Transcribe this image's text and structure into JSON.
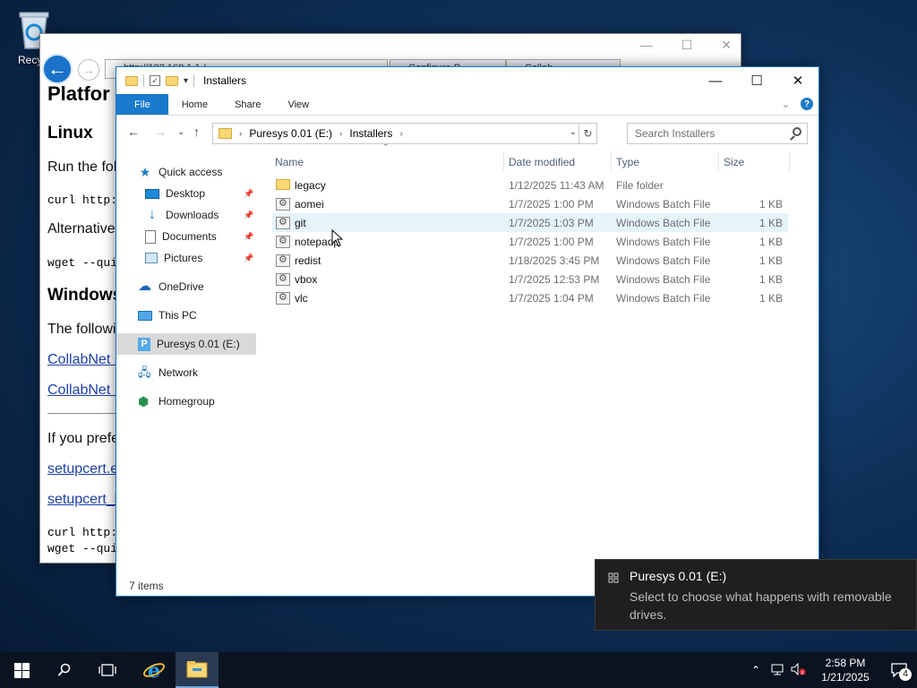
{
  "desktop": {
    "recycle_bin_label": "Recycl"
  },
  "browser": {
    "address": "http://192.168.1.1 /",
    "tabs": [
      "Configure P...",
      "Collab..."
    ],
    "content": {
      "heading": "Platfor",
      "linux_heading": "Linux",
      "linux_text": "Run the fol",
      "curl_line": "curl http:",
      "alt_text": "Alternative",
      "wget_line": "wget --qui",
      "windows_heading": "Windows",
      "windows_text": "The followi",
      "link1": "CollabNet I",
      "link2": "CollabNet I",
      "prefer_text": "If you prefe",
      "link3": "setupcert.e",
      "link4": "setupcert_l",
      "curl_line2": "curl http:",
      "wget_line2": "wget --qui"
    }
  },
  "explorer": {
    "title": "Installers",
    "ribbon_tabs": [
      "File",
      "Home",
      "Share",
      "View"
    ],
    "breadcrumb": [
      "Puresys 0.01 (E:)",
      "Installers"
    ],
    "search_placeholder": "Search Installers",
    "columns": [
      "Name",
      "Date modified",
      "Type",
      "Size"
    ],
    "sidebar": {
      "quick_access": "Quick access",
      "desktop": "Desktop",
      "downloads": "Downloads",
      "documents": "Documents",
      "pictures": "Pictures",
      "onedrive": "OneDrive",
      "this_pc": "This PC",
      "drive": "Puresys 0.01 (E:)",
      "network": "Network",
      "homegroup": "Homegroup"
    },
    "files": [
      {
        "name": "legacy",
        "date": "1/12/2025 11:43 AM",
        "type": "File folder",
        "size": "",
        "icon": "folder-icon"
      },
      {
        "name": "aomei",
        "date": "1/7/2025 1:00 PM",
        "type": "Windows Batch File",
        "size": "1 KB",
        "icon": "batch-file-icon"
      },
      {
        "name": "git",
        "date": "1/7/2025 1:03 PM",
        "type": "Windows Batch File",
        "size": "1 KB",
        "icon": "batch-file-icon"
      },
      {
        "name": "notepadp",
        "date": "1/7/2025 1:00 PM",
        "type": "Windows Batch File",
        "size": "1 KB",
        "icon": "batch-file-icon"
      },
      {
        "name": "redist",
        "date": "1/18/2025 3:45 PM",
        "type": "Windows Batch File",
        "size": "1 KB",
        "icon": "batch-file-icon"
      },
      {
        "name": "vbox",
        "date": "1/7/2025 12:53 PM",
        "type": "Windows Batch File",
        "size": "1 KB",
        "icon": "batch-file-icon"
      },
      {
        "name": "vlc",
        "date": "1/7/2025 1:04 PM",
        "type": "Windows Batch File",
        "size": "1 KB",
        "icon": "batch-file-icon"
      }
    ],
    "status": "7 items"
  },
  "toast": {
    "title": "Puresys 0.01 (E:)",
    "body": "Select to choose what happens with removable drives."
  },
  "taskbar": {
    "time": "2:58 PM",
    "date": "1/21/2025",
    "notification_count": "4"
  },
  "colors": {
    "accent": "#1979ca",
    "desktop_bg": "#0d2f57",
    "taskbar_bg": "#0b1320",
    "toast_bg": "#1f1f1f"
  }
}
